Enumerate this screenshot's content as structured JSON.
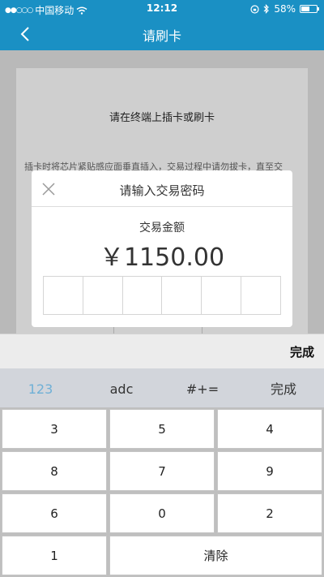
{
  "status_bar": {
    "signal_dots": "●●○○○",
    "carrier": "中国移动",
    "time": "12:12",
    "battery": "58%",
    "battery_level": 0.58
  },
  "nav": {
    "title": "请刷卡",
    "back_icon": "chevron-left-icon"
  },
  "background": {
    "heading": "请在终端上插卡或刷卡",
    "instructions": "插卡时将芯片紧贴感应面垂直插入，交易过程中请勿拔卡，直至交"
  },
  "dialog": {
    "title": "请输入交易密码",
    "amount_label": "交易金额",
    "amount": "￥1150.00",
    "password_digits": [
      "",
      "",
      "",
      "",
      "",
      ""
    ]
  },
  "keyboard": {
    "done_top": "完成",
    "modes": [
      "123",
      "adc",
      "#+=",
      "完成"
    ],
    "keys": [
      [
        "3",
        "5",
        "4"
      ],
      [
        "8",
        "7",
        "9"
      ],
      [
        "6",
        "0",
        "2"
      ],
      [
        "1",
        "清除"
      ]
    ]
  },
  "colors": {
    "primary": "#1a90c4",
    "mode_active": "#6fb0d6"
  }
}
